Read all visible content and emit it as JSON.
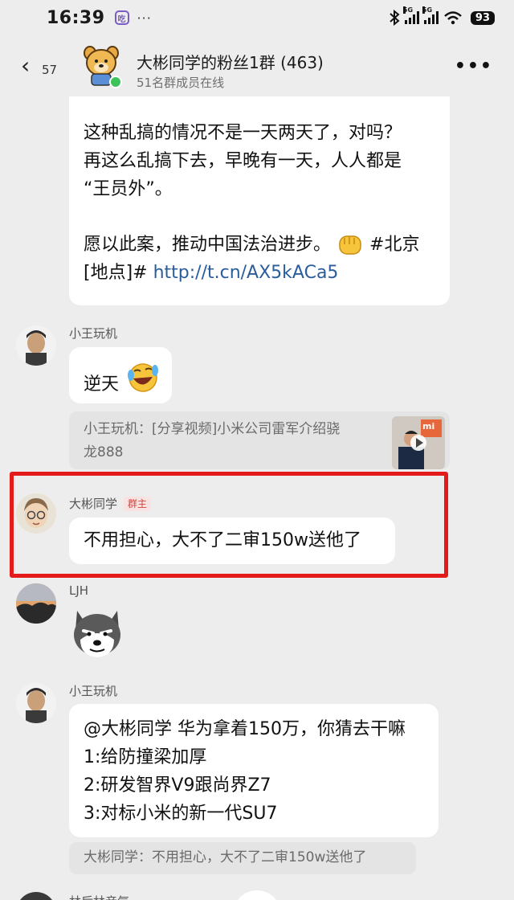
{
  "status_bar": {
    "time": "16:39",
    "app_badge": "吃",
    "dots": "···",
    "net1": "5G",
    "net2": "5G",
    "battery": "93"
  },
  "header": {
    "unread_count": "57",
    "title": "大彬同学的粉丝1群 (463)",
    "subtitle": "51名群成员在线"
  },
  "messages": {
    "m1": {
      "line1": "这种乱搞的情况不是一天两天了，对吗？",
      "line2": "再这么乱搞下去，早晚有一天，人人都是",
      "line3": "“王员外”。",
      "line4_a": "愿以此案，推动中国法治进步。",
      "line4_b": "#北京",
      "line5_a": "[地点]# ",
      "link": "http://t.cn/AX5kACa5"
    },
    "m2": {
      "sender": "小王玩机",
      "text": "逆天",
      "quote_line1": "小王玩机：[分享视频]小米公司雷军介绍骁",
      "quote_line2": "龙888",
      "thumb_logo": "mi"
    },
    "m3": {
      "sender": "大彬同学",
      "role_badge": "群主",
      "text": "不用担心，大不了二审150w送他了"
    },
    "m4": {
      "sender": "LJH"
    },
    "m5": {
      "sender": "小王玩机",
      "line1": "@大彬同学 华为拿着150万，你猜去干嘛",
      "line2": "1:给防撞梁加厚",
      "line3": "2:研发智界V9跟尚界Z7",
      "line4": "3:对标小米的新一代SU7",
      "quote": "大彬同学：不用担心，大不了二审150w送他了"
    },
    "m6": {
      "sender": "林后林音气"
    }
  },
  "colors": {
    "background": "#ededed",
    "bubble": "#ffffff",
    "link": "#2a5d9a",
    "highlight_box": "#e31b1b",
    "online": "#3cc45a"
  }
}
